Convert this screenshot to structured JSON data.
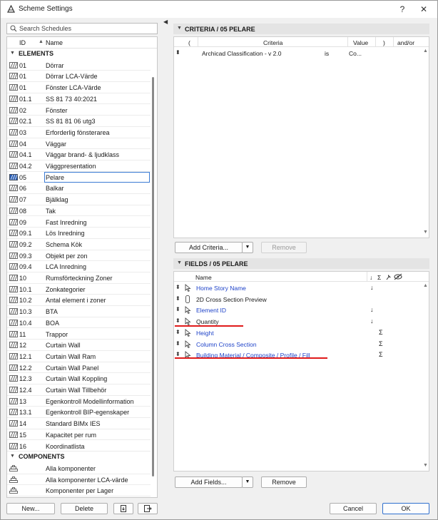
{
  "window": {
    "title": "Scheme Settings",
    "help_label": "?",
    "close_label": "✕"
  },
  "search": {
    "placeholder": "Search Schedules"
  },
  "list": {
    "col_id": "ID",
    "col_name": "Name",
    "groups": [
      {
        "label": "ELEMENTS",
        "items": [
          {
            "id": "01",
            "name": "Dörrar"
          },
          {
            "id": "01",
            "name": "Dörrar LCA-Värde"
          },
          {
            "id": "01",
            "name": "Fönster LCA-Värde"
          },
          {
            "id": "01.1",
            "name": "SS 81 73 40:2021"
          },
          {
            "id": "02",
            "name": "Fönster"
          },
          {
            "id": "02.1",
            "name": "SS 81 81 06 utg3"
          },
          {
            "id": "03",
            "name": "Erforderlig fönsterarea"
          },
          {
            "id": "04",
            "name": "Väggar"
          },
          {
            "id": "04.1",
            "name": "Väggar brand- & ljudklass"
          },
          {
            "id": "04.2",
            "name": "Väggpresentation"
          },
          {
            "id": "05",
            "name": "Pelare",
            "selected": true
          },
          {
            "id": "06",
            "name": "Balkar"
          },
          {
            "id": "07",
            "name": "Bjälklag"
          },
          {
            "id": "08",
            "name": "Tak"
          },
          {
            "id": "09",
            "name": "Fast Inredning"
          },
          {
            "id": "09.1",
            "name": "Lös Inredning"
          },
          {
            "id": "09.2",
            "name": "Schema Kök"
          },
          {
            "id": "09.3",
            "name": "Objekt per zon"
          },
          {
            "id": "09.4",
            "name": "LCA Inredning"
          },
          {
            "id": "10",
            "name": "Rumsförteckning Zoner"
          },
          {
            "id": "10.1",
            "name": "Zonkategorier"
          },
          {
            "id": "10.2",
            "name": "Antal element i zoner"
          },
          {
            "id": "10.3",
            "name": "BTA"
          },
          {
            "id": "10.4",
            "name": "BOA"
          },
          {
            "id": "11",
            "name": "Trappor"
          },
          {
            "id": "12",
            "name": "Curtain Wall"
          },
          {
            "id": "12.1",
            "name": "Curtain Wall Ram"
          },
          {
            "id": "12.2",
            "name": "Curtain Wall Panel"
          },
          {
            "id": "12.3",
            "name": "Curtain Wall Koppling"
          },
          {
            "id": "12.4",
            "name": "Curtain Wall Tillbehör"
          },
          {
            "id": "13",
            "name": "Egenkontroll Modellinformation"
          },
          {
            "id": "13.1",
            "name": "Egenkontroll BIP-egenskaper"
          },
          {
            "id": "14",
            "name": "Standard BIMx IES"
          },
          {
            "id": "15",
            "name": "Kapacitet per rum"
          },
          {
            "id": "16",
            "name": "Koordinatlista"
          }
        ]
      },
      {
        "label": "COMPONENTS",
        "items": [
          {
            "id": "",
            "name": "Alla komponenter"
          },
          {
            "id": "",
            "name": "Alla komponenter LCA-värde"
          },
          {
            "id": "",
            "name": "Komponenter per Lager"
          }
        ]
      }
    ]
  },
  "left_buttons": {
    "new": "New...",
    "delete": "Delete"
  },
  "criteria": {
    "header": "CRITERIA / 05 PELARE",
    "columns": {
      "open_paren": "(",
      "criteria": "Criteria",
      "value": "Value",
      "close_paren": ")",
      "andor": "and/or"
    },
    "rows": [
      {
        "criteria": "Archicad Classification - v 2.0",
        "op": "is",
        "value": "Co..."
      }
    ],
    "add_label": "Add Criteria...",
    "remove_label": "Remove"
  },
  "fields": {
    "header": "FIELDS / 05 PELARE",
    "col_name": "Name",
    "col_sort": "↓",
    "col_sum": "Σ",
    "rows": [
      {
        "name": "Home Story Name",
        "link": true,
        "sort": "↓",
        "sum": ""
      },
      {
        "name": "2D Cross Section Preview",
        "link": false,
        "sort": "",
        "sum": ""
      },
      {
        "name": "Element ID",
        "link": true,
        "sort": "↓",
        "sum": ""
      },
      {
        "name": "Quantity",
        "link": false,
        "sort": "↓",
        "sum": ""
      },
      {
        "name": "Height",
        "link": true,
        "sort": "",
        "sum": "Σ"
      },
      {
        "name": "Column Cross Section",
        "link": true,
        "sort": "",
        "sum": "Σ"
      },
      {
        "name": "Building Material / Composite / Profile / Fill",
        "link": true,
        "sort": "",
        "sum": "Σ"
      }
    ],
    "add_label": "Add Fields...",
    "remove_label": "Remove"
  },
  "dialog_buttons": {
    "cancel": "Cancel",
    "ok": "OK"
  },
  "colors": {
    "accent": "#2f6fce",
    "link": "#1f43c9",
    "highlight": "#e01a1a"
  }
}
